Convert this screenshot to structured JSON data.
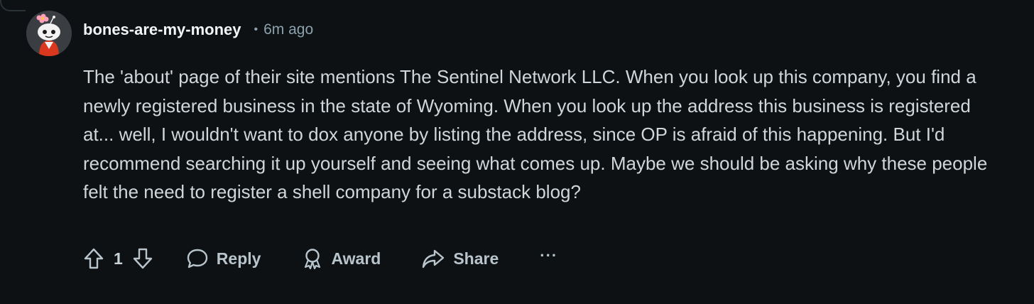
{
  "comment": {
    "avatar_icon": "snoo-avatar-icon",
    "username": "bones-are-my-money",
    "separator": "•",
    "timestamp": "6m ago",
    "body": "The 'about' page of their site mentions The Sentinel Network LLC. When you look up this company, you find a newly registered business in the state of Wyoming. When you look up the address this business is registered at... well, I wouldn't want to dox anyone by listing the address, since OP is afraid of this happening. But I'd recommend searching it up yourself and seeing what comes up. Maybe we should be asking why these people felt the need to register a shell company for a substack blog?"
  },
  "actions": {
    "vote_count": "1",
    "reply_label": "Reply",
    "award_label": "Award",
    "share_label": "Share",
    "more_label": "···"
  },
  "colors": {
    "background": "#0e1113",
    "text": "#d0d6d9",
    "muted": "#8ba2ad",
    "action": "#b8c5cc"
  }
}
